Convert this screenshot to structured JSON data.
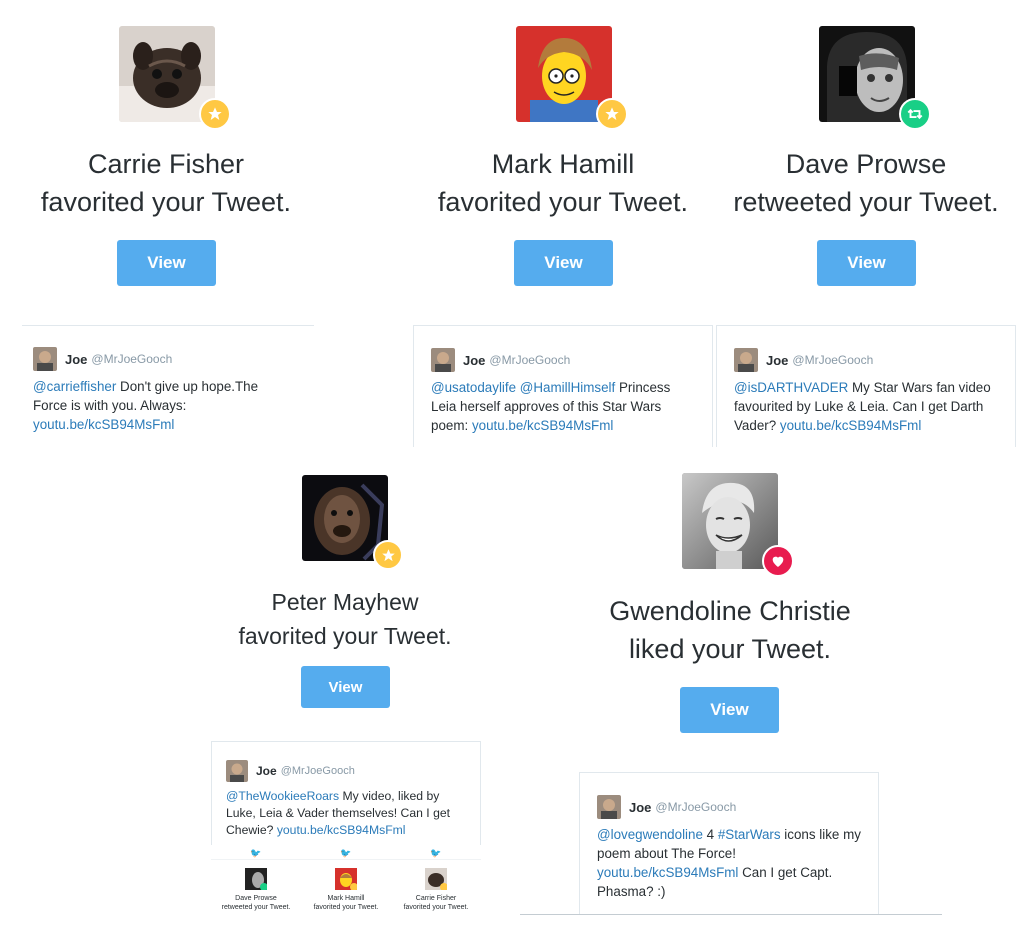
{
  "notifications": [
    {
      "name": "Carrie Fisher",
      "action": "favorited your Tweet.",
      "badge": "star-icon",
      "view": "View"
    },
    {
      "name": "Mark Hamill",
      "action": "favorited your Tweet.",
      "badge": "star-icon",
      "view": "View"
    },
    {
      "name": "Dave Prowse",
      "action": "retweeted your Tweet.",
      "badge": "retweet-icon",
      "view": "View"
    },
    {
      "name": "Peter Mayhew",
      "action": "favorited your Tweet.",
      "badge": "star-icon",
      "view": "View"
    },
    {
      "name": "Gwendoline Christie",
      "action": "liked your Tweet.",
      "badge": "heart-icon",
      "view": "View"
    }
  ],
  "tweets": [
    {
      "author": "Joe",
      "handle": "@MrJoeGooch",
      "mention": "@carrieffisher",
      "text1": " Don't give up hope.The Force is with you. Always: ",
      "link": "youtu.be/kcSB94MsFml"
    },
    {
      "author": "Joe",
      "handle": "@MrJoeGooch",
      "mention": "@usatodaylife",
      "mention2": "@HamillHimself",
      "text1": " Princess Leia herself approves of this Star Wars poem: ",
      "link": "youtu.be/kcSB94MsFml"
    },
    {
      "author": "Joe",
      "handle": "@MrJoeGooch",
      "mention": "@isDARTHVADER",
      "text1": " My Star Wars fan video favourited by Luke & Leia. Can I get Darth Vader? ",
      "link": "youtu.be/kcSB94MsFml"
    },
    {
      "author": "Joe",
      "handle": "@MrJoeGooch",
      "mention": "@TheWookieeRoars",
      "text1": " My video, liked by Luke, Leia & Vader themselves! Can I get Chewie? ",
      "link": "youtu.be/kcSB94MsFml"
    },
    {
      "author": "Joe",
      "handle": "@MrJoeGooch",
      "mention": "@lovegwendoline",
      "text1": " 4 ",
      "hashtag": "#StarWars",
      "text2": " icons like my poem about The Force! ",
      "link": "youtu.be/kcSB94MsFml",
      "text3": " Can I get Capt. Phasma? :)"
    }
  ],
  "mini_strip": [
    {
      "name": "Dave Prowse",
      "action": "retweeted your Tweet."
    },
    {
      "name": "Mark Hamill",
      "action": "favorited your Tweet."
    },
    {
      "name": "Carrie Fisher",
      "action": "favorited your Tweet."
    }
  ],
  "colors": {
    "accent": "#55acee",
    "star": "#ffc843",
    "retweet": "#19cf86",
    "like": "#e81c4f",
    "link": "#2b7bb9"
  }
}
